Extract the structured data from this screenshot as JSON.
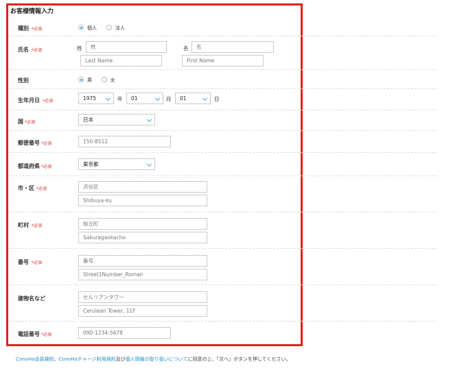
{
  "section_title": "お客様情報入力",
  "required_mark": "*必須",
  "type": {
    "label": "種別",
    "options": [
      "個人",
      "法人"
    ],
    "selected": 0
  },
  "name": {
    "label": "氏名",
    "sei_label": "姓",
    "mei_label": "名",
    "sei_placeholder": "姓",
    "mei_placeholder": "名",
    "last_placeholder": "Last Name",
    "first_placeholder": "First Name"
  },
  "gender": {
    "label": "性別",
    "options": [
      "男",
      "女"
    ],
    "selected": 0
  },
  "birth": {
    "label": "生年月日",
    "year": "1975",
    "year_unit": "年",
    "month": "01",
    "month_unit": "月",
    "day": "01",
    "day_unit": "日"
  },
  "country": {
    "label": "国",
    "value": "日本"
  },
  "postal": {
    "label": "郵便番号",
    "placeholder": "150-8512"
  },
  "prefecture": {
    "label": "都道府県",
    "value": "東京都"
  },
  "city": {
    "label": "市・区",
    "placeholder": "渋谷区",
    "roman_placeholder": "Shibuya-ku"
  },
  "town": {
    "label": "町村",
    "placeholder": "桜丘町",
    "roman_placeholder": "Sakuragaokacho"
  },
  "street": {
    "label": "番号",
    "placeholder": "番号",
    "roman_placeholder": "Street1Number_Roman"
  },
  "building": {
    "label": "建物名など",
    "placeholder": "セルリアンタワー",
    "roman_placeholder": "Cerulean Tower, 11F"
  },
  "phone": {
    "label": "電話番号",
    "placeholder": "090-1234-5678"
  },
  "footer": {
    "link1": "ConoHa会員規約",
    "sep1": "、",
    "link2": "ConoHaチャージ利用規約",
    "sep2": "及び",
    "link3": "個人情報の取り扱いについて",
    "text": "に同意の上、「次へ」ボタンを押してください。"
  }
}
